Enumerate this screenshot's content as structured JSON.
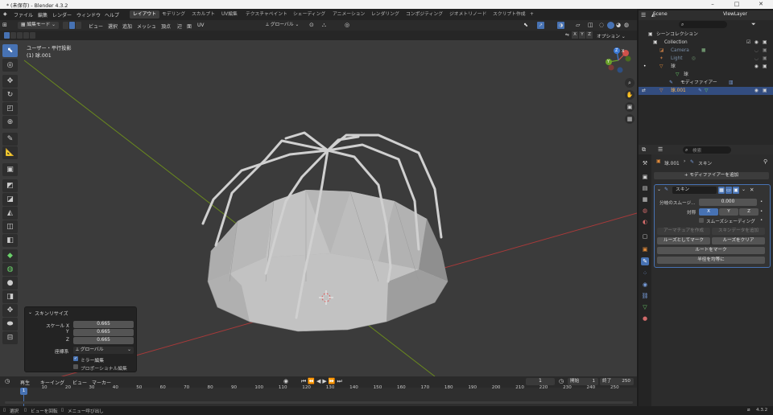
{
  "window": {
    "title": "* (未保存) - Blender 4.3.2",
    "minimize": "–",
    "maximize": "□",
    "close": "✕"
  },
  "menus": [
    "ファイル",
    "編集",
    "レンダー",
    "ウィンドウ",
    "ヘルプ"
  ],
  "workspaces": [
    {
      "label": "レイアウト",
      "active": true
    },
    {
      "label": "モデリング"
    },
    {
      "label": "スカルプト"
    },
    {
      "label": "UV編集"
    },
    {
      "label": "テクスチャペイント"
    },
    {
      "label": "シェーディング"
    },
    {
      "label": "アニメーション"
    },
    {
      "label": "レンダリング"
    },
    {
      "label": "コンポジティング"
    },
    {
      "label": "ジオメトリノード"
    },
    {
      "label": "スクリプト作成"
    },
    {
      "label": "+"
    }
  ],
  "scene": {
    "scene_name": "Scene",
    "view_layer": "ViewLayer"
  },
  "editor_header": {
    "mode": "編集モード",
    "menus": [
      "ビュー",
      "選択",
      "追加",
      "メッシュ",
      "頂点",
      "辺",
      "面",
      "UV"
    ],
    "transform_orientation": "グローバル",
    "axes": [
      "X",
      "Y",
      "Z"
    ],
    "options": "オプション"
  },
  "viewport": {
    "view_name": "ユーザー・平行投影",
    "object_label": "(1) 球.001",
    "gizmo_axes": [
      "X",
      "Y",
      "Z"
    ]
  },
  "operator_panel": {
    "title": "スキンリサイズ",
    "fields": [
      {
        "label": "スケール X",
        "value": "0.665"
      },
      {
        "label": "Y",
        "value": "0.665"
      },
      {
        "label": "Z",
        "value": "0.665"
      }
    ],
    "orientation_label": "座標系",
    "orientation_value": "グローバル",
    "mirror_edit": "ミラー編集",
    "proportional_edit": "プロポーショナル編集"
  },
  "timeline": {
    "menus": [
      "再生",
      "キーイング",
      "ビュー",
      "マーカー"
    ],
    "current_frame": "1",
    "start_label": "開始",
    "start": "1",
    "end_label": "終了",
    "end": "250",
    "ticks": [
      "1",
      "10",
      "20",
      "30",
      "40",
      "50",
      "60",
      "70",
      "80",
      "90",
      "100",
      "110",
      "120",
      "130",
      "140",
      "150",
      "160",
      "170",
      "180",
      "190",
      "200",
      "210",
      "220",
      "230",
      "240",
      "250"
    ]
  },
  "status_bar": {
    "items": [
      "選択",
      "ビューを回転",
      "メニュー呼び出し"
    ],
    "version": "4.3.2"
  },
  "outliner": {
    "search_placeholder": "",
    "root": "シーンコレクション",
    "items": [
      {
        "label": "Collection",
        "level": 1,
        "icon": "collection-icon"
      },
      {
        "label": "Camera",
        "level": 2,
        "icon": "camera-icon",
        "dim": true
      },
      {
        "label": "Light",
        "level": 2,
        "icon": "light-icon",
        "dim": true
      },
      {
        "label": "球",
        "level": 2,
        "icon": "mesh-icon"
      },
      {
        "label": "球",
        "level": 3,
        "icon": "mesh-data-icon"
      },
      {
        "label": "モディファイアー",
        "level": 3,
        "icon": "wrench-icon"
      },
      {
        "label": "球.001",
        "level": 2,
        "icon": "mesh-icon",
        "selected": true
      }
    ]
  },
  "properties": {
    "search_placeholder": "検索",
    "breadcrumb_object": "球.001",
    "breadcrumb_modifier": "スキン",
    "add_modifier": "+ モディファイアーを追加",
    "modifier_name": "スキン",
    "branch_smoothing_label": "分岐のスムージ…",
    "branch_smoothing_value": "0.000",
    "symmetry_label": "対称",
    "symmetry_axes": [
      "X",
      "Y",
      "Z"
    ],
    "smooth_shading": "スムーズシェーディング",
    "create_armature": "アーマチュアを作成",
    "add_skin_data": "スキンデータを追加",
    "mark_loose": "ルーズとしてマーク",
    "clear_loose": "ルーズをクリア",
    "mark_root": "ルートをマーク",
    "equalize_radii": "半径を均等に"
  },
  "colors": {
    "accent": "#4772b3",
    "x_axis": "#a83a3a",
    "y_axis": "#6a8a1e",
    "selected_row": "#334d80"
  }
}
